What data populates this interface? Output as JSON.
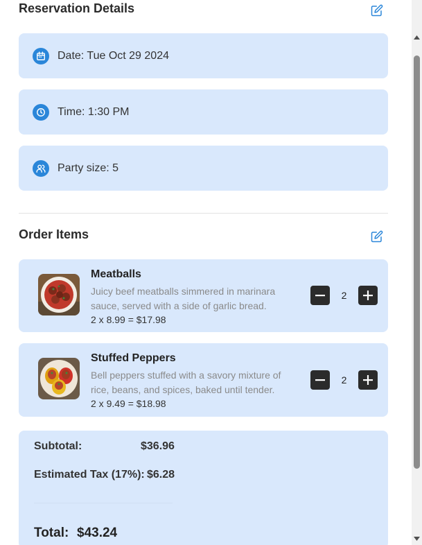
{
  "reservation": {
    "title": "Reservation Details",
    "edit_icon": "edit-icon",
    "date": {
      "icon": "calendar-icon",
      "text": "Date: Tue Oct 29 2024"
    },
    "time": {
      "icon": "clock-icon",
      "text": "Time: 1:30 PM"
    },
    "party": {
      "icon": "users-icon",
      "text": "Party size: 5"
    }
  },
  "order": {
    "title": "Order Items",
    "edit_icon": "edit-icon",
    "items": [
      {
        "name": "Meatballs",
        "description": "Juicy beef meatballs simmered in marinara sauce, served with a side of garlic bread.",
        "calc": "2 x 8.99 = $17.98",
        "quantity": "2"
      },
      {
        "name": "Stuffed Peppers",
        "description": "Bell peppers stuffed with a savory mixture of rice, beans, and spices, baked until tender.",
        "calc": "2 x 9.49 = $18.98",
        "quantity": "2"
      }
    ]
  },
  "summary": {
    "subtotal_label": "Subtotal:",
    "subtotal_value": "$36.96",
    "tax_label": "Estimated Tax (17%):",
    "tax_value": "$6.28",
    "total_label": "Total:",
    "total_value": "$43.24"
  },
  "colors": {
    "card_bg": "#d9e8fc",
    "accent": "#2a86d9",
    "stepper": "#2b2b2b"
  }
}
